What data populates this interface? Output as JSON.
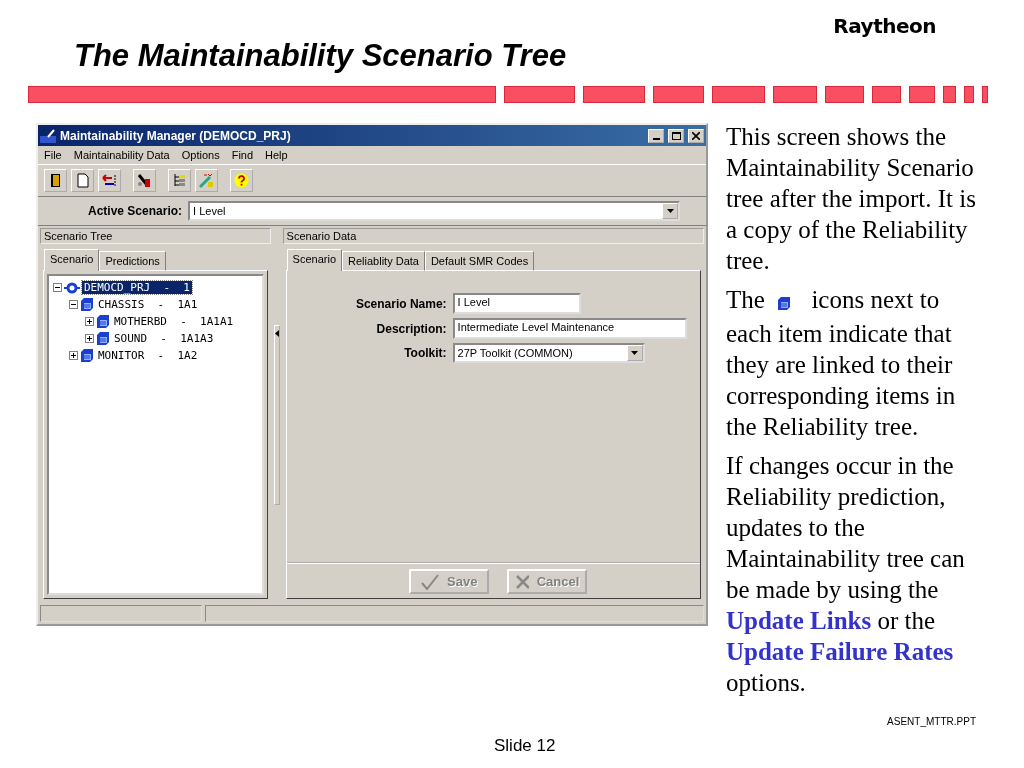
{
  "slide": {
    "logo": "Raytheon",
    "title": "The Maintainability Scenario Tree",
    "file_name": "ASENT_MTTR.PPT",
    "footer": "Slide 12"
  },
  "window": {
    "title": "Maintainability Manager (DEMOCD_PRJ)",
    "menu": [
      "File",
      "Maintainability Data",
      "Options",
      "Find",
      "Help"
    ],
    "toolbar": [
      {
        "kind": "exit"
      },
      {
        "kind": "new"
      },
      {
        "kind": "import"
      },
      {
        "kind": "tools"
      },
      {
        "kind": "tree"
      },
      {
        "kind": "wizard"
      },
      {
        "kind": "help"
      }
    ],
    "active_scenario": {
      "label": "Active Scenario:",
      "value": "I Level"
    },
    "left_panel": {
      "title": "Scenario Tree",
      "tabs": [
        {
          "label": "Scenario",
          "selected": true
        },
        {
          "label": "Predictions",
          "selected": false
        }
      ],
      "tree": [
        {
          "label": "DEMOCD_PRJ  -  1",
          "kind": "project",
          "selected": true,
          "expanded": true,
          "children": [
            {
              "label": "CHASSIS  -  1A1",
              "kind": "item",
              "selected": false,
              "expanded": true,
              "children": [
                {
                  "label": "MOTHERBD  -  1A1A1",
                  "kind": "item",
                  "selected": false,
                  "expanded": false
                },
                {
                  "label": "SOUND  -  1A1A3",
                  "kind": "item",
                  "selected": false,
                  "expanded": false
                }
              ]
            },
            {
              "label": "MONITOR  -  1A2",
              "kind": "item",
              "selected": false,
              "expanded": false
            }
          ]
        }
      ]
    },
    "right_panel": {
      "title": "Scenario Data",
      "tabs": [
        {
          "label": "Scenario",
          "selected": true
        },
        {
          "label": "Reliablity Data",
          "selected": false
        },
        {
          "label": "Default SMR Codes",
          "selected": false
        }
      ],
      "fields": [
        {
          "label": "Scenario Name:",
          "value": "I Level",
          "kind": "short"
        },
        {
          "label": "Description:",
          "value": "Intermediate Level Maintenance",
          "kind": "long"
        },
        {
          "label": "Toolkit:",
          "value": "27P Toolkit (COMMON)",
          "kind": "select"
        }
      ],
      "buttons": [
        {
          "label": "Save",
          "kind": "save",
          "disabled": true
        },
        {
          "label": "Cancel",
          "kind": "cancel",
          "disabled": true
        }
      ]
    }
  },
  "notes": [
    {
      "segments": [
        {
          "kind": "text",
          "text": "This screen shows the Maintainability Scenario tree after the import. It is a copy of the Reliability tree."
        }
      ]
    },
    {
      "segments": [
        {
          "kind": "text",
          "text": "The"
        },
        {
          "kind": "icon"
        },
        {
          "kind": "text",
          "text": "icons next to each item indicate that they are linked to their corresponding items in the Reliability tree."
        }
      ]
    },
    {
      "segments": [
        {
          "kind": "text",
          "text": "If changes occur in the Reliability prediction, updates to the Maintainability tree can be made by using the"
        },
        {
          "kind": "link",
          "text": "Update Links"
        },
        {
          "kind": "text",
          "text": "or the"
        },
        {
          "kind": "link",
          "text": "Update Failure Rates"
        },
        {
          "kind": "text",
          "text": "options."
        }
      ]
    }
  ]
}
